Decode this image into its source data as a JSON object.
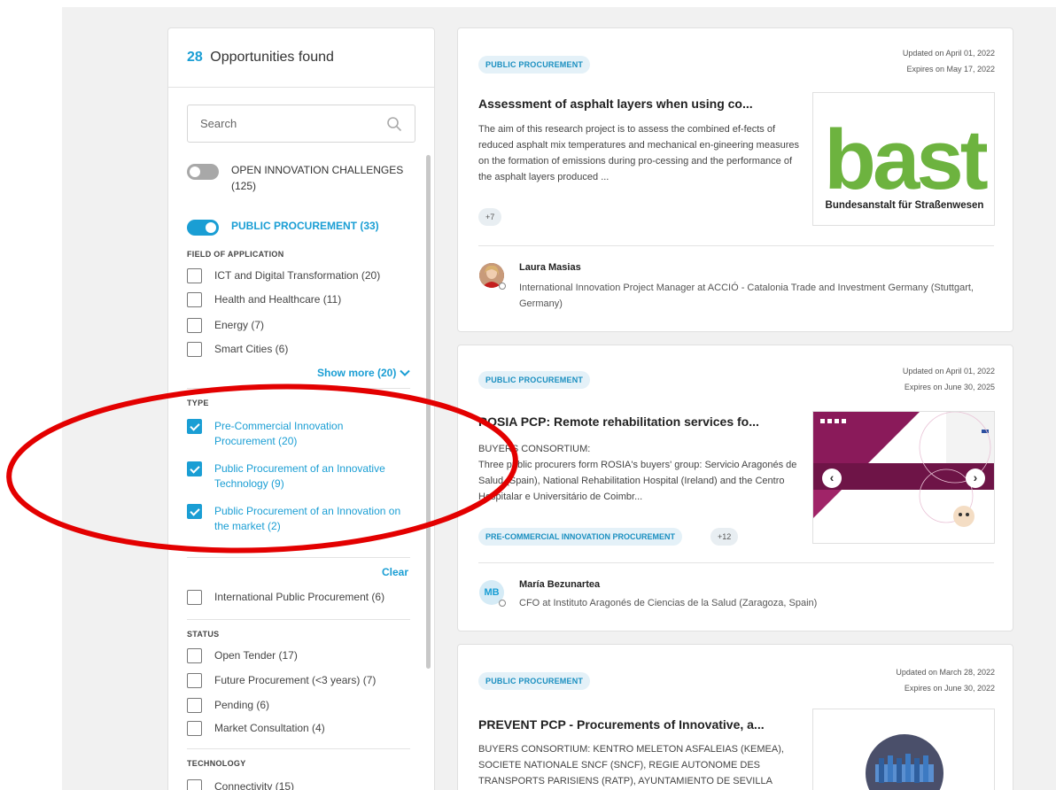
{
  "results": {
    "count": "28",
    "label": "Opportunities found"
  },
  "search": {
    "placeholder": "Search"
  },
  "toggles": [
    {
      "label": "OPEN INNOVATION CHALLENGES (125)",
      "on": false
    },
    {
      "label": "PUBLIC PROCUREMENT (33)",
      "on": true
    }
  ],
  "field_of_application": {
    "title": "FIELD OF APPLICATION",
    "items": [
      {
        "label": "ICT and Digital Transformation (20)",
        "checked": false
      },
      {
        "label": "Health and Healthcare (11)",
        "checked": false
      },
      {
        "label": "Energy (7)",
        "checked": false
      },
      {
        "label": "Smart Cities (6)",
        "checked": false
      }
    ],
    "show_more": "Show more (20)"
  },
  "type": {
    "title": "TYPE",
    "items": [
      {
        "label": "Pre-Commercial Innovation Procurement (20)",
        "checked": true
      },
      {
        "label": "Public Procurement of an Innovative Technology (9)",
        "checked": true
      },
      {
        "label": "Public Procurement of an Innovation on the market (2)",
        "checked": true
      }
    ],
    "clear": "Clear",
    "extra": {
      "label": "International Public Procurement (6)",
      "checked": false
    }
  },
  "status": {
    "title": "STATUS",
    "items": [
      {
        "label": "Open Tender (17)",
        "checked": false
      },
      {
        "label": "Future Procurement (<3 years) (7)",
        "checked": false
      },
      {
        "label": "Pending (6)",
        "checked": false
      },
      {
        "label": "Market Consultation (4)",
        "checked": false
      }
    ]
  },
  "technology": {
    "title": "TECHNOLOGY",
    "items": [
      {
        "label": "Connectivity (15)",
        "checked": false
      }
    ]
  },
  "cards": [
    {
      "badge": "PUBLIC PROCUREMENT",
      "updated": "Updated on April 01, 2022",
      "expires": "Expires on May 17, 2022",
      "title": "Assessment of asphalt layers when using co...",
      "description": "The aim of this research project is to assess the combined ef-fects of reduced asphalt mix temperatures and mechanical en-gineering measures on the formation of emissions during pro-cessing and the performance of the asphalt layers produced ...",
      "chip_more": "+7",
      "image": {
        "logo_text": "bast",
        "caption": "Bundesanstalt für Straßenwesen"
      },
      "person": {
        "name": "Laura Masias",
        "role": "International Innovation Project Manager at ACCIÓ - Catalonia Trade and Investment Germany (Stuttgart, Germany)"
      }
    },
    {
      "badge": "PUBLIC PROCUREMENT",
      "updated": "Updated on April 01, 2022",
      "expires": "Expires on June 30, 2025",
      "title": "ROSIA PCP: Remote rehabilitation services fo...",
      "description_line1": "BUYERS CONSORTIUM:",
      "description": "Three public procurers form ROSIA's buyers' group: Servicio Aragonés de Salud (Spain), National Rehabilitation Hospital (Ireland) and the Centro Hospitalar e Universitário de Coimbr...",
      "chip_type": "PRE-COMMERCIAL INNOVATION PROCUREMENT",
      "chip_more": "+12",
      "person": {
        "initials": "MB",
        "name": "María Bezunartea",
        "role": "CFO at Instituto Aragonés de Ciencias de la Salud (Zaragoza, Spain)"
      }
    },
    {
      "badge": "PUBLIC PROCUREMENT",
      "updated": "Updated on March 28, 2022",
      "expires": "Expires on June 30, 2022",
      "title": "PREVENT PCP - Procurements of Innovative, a...",
      "description": "BUYERS CONSORTIUM: KENTRO MELETON ASFALEIAS (KEMEA), SOCIETE NATIONALE SNCF (SNCF), REGIE AUTONOME DES TRANSPORTS PARISIENS (RATP),  AYUNTAMIENTO DE SEVILLA"
    }
  ],
  "colors": {
    "accent": "#1a9ed4",
    "annotation": "#e30000",
    "bast_green": "#6db33f"
  }
}
